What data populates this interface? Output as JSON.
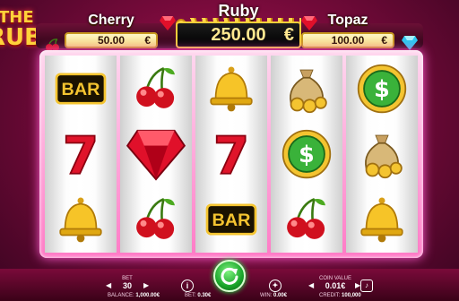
{
  "game": {
    "logo_line1": "THE",
    "logo_line2": "RUBY"
  },
  "jackpots": {
    "cherry": {
      "label": "Cherry",
      "value": "50.00",
      "currency": "€"
    },
    "ruby": {
      "label": "Ruby",
      "value": "250.00",
      "currency": "€"
    },
    "topaz": {
      "label": "Topaz",
      "value": "100.00",
      "currency": "€"
    }
  },
  "reels": [
    [
      "bar",
      "seven",
      "bell"
    ],
    [
      "cherry",
      "ruby",
      "cherry"
    ],
    [
      "bell",
      "seven",
      "bar"
    ],
    [
      "money-bag",
      "dollar-coin",
      "cherry"
    ],
    [
      "dollar-coin",
      "money-bag",
      "bell"
    ]
  ],
  "symbol_text": {
    "bar": "BAR",
    "seven": "7",
    "coin": "$"
  },
  "bottom": {
    "bet_label": "BET",
    "bet_value": "30",
    "coin_value_label": "COIN VALUE",
    "coin_value": "0.01€",
    "balance_label": "BALANCE:",
    "balance_value": "1,000.00€",
    "bet_total_label": "BET:",
    "bet_total_value": "0.30€",
    "win_label": "WIN:",
    "win_value": "0.00€",
    "credit_label": "CREDIT:",
    "credit_value": "100,000",
    "info_icon_text": "i"
  },
  "colors": {
    "background": "#7a0b3c",
    "reel_frame": "#ff7ac6",
    "spin_button": "#19a52a",
    "jackpot_gold": "#ffcf3a"
  }
}
